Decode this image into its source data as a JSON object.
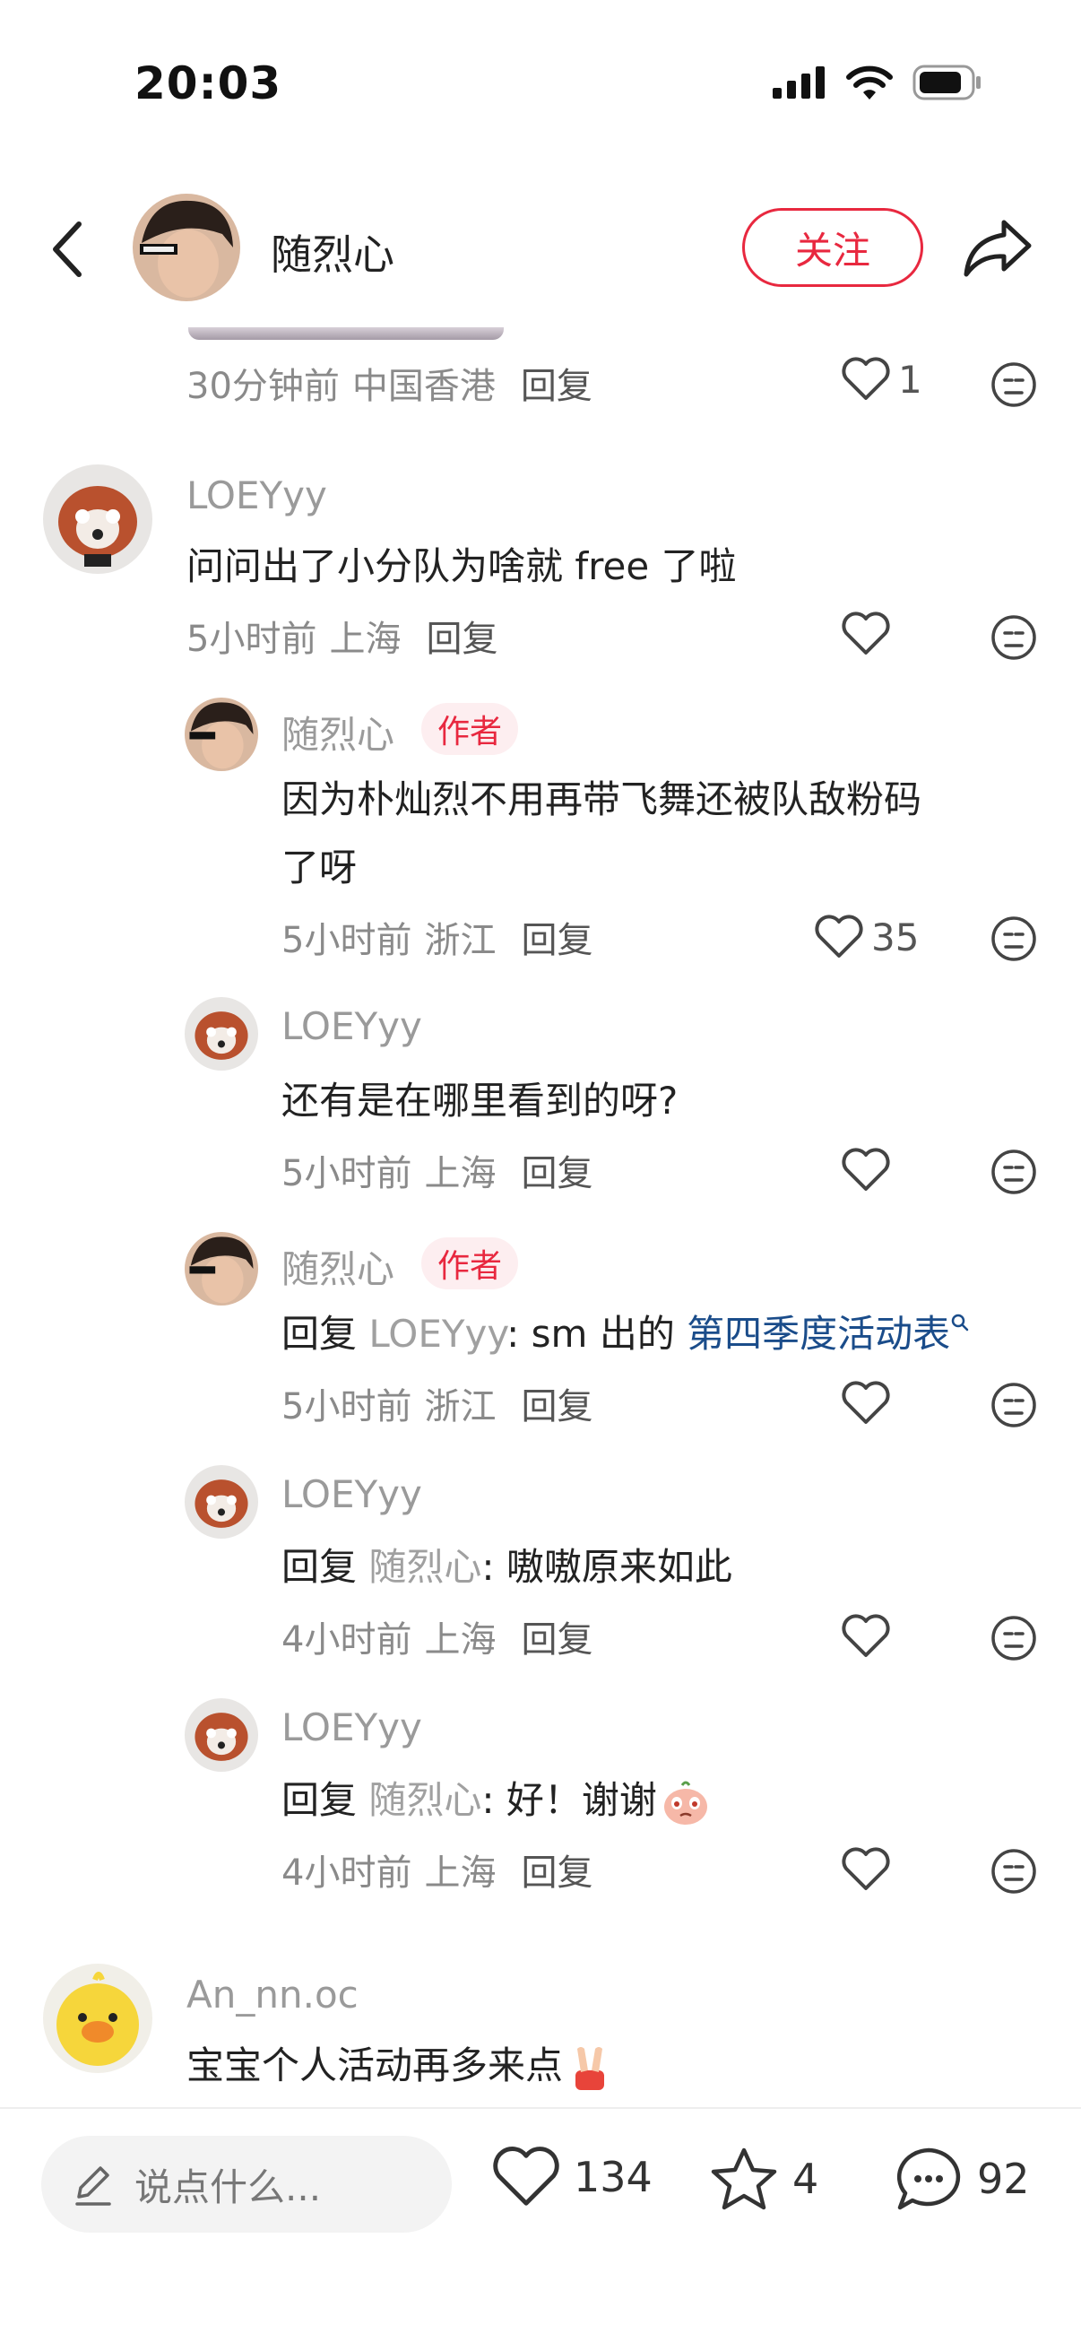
{
  "status_bar": {
    "time": "20:03"
  },
  "header": {
    "author_name": "随烈心",
    "follow_label": "关注"
  },
  "top_comment_meta": {
    "time": "30分钟前",
    "location": "中国香港",
    "reply": "回复",
    "likes": "1"
  },
  "comment1": {
    "name": "LOEYyy",
    "text": "问问出了小分队为啥就 free 了啦",
    "time": "5小时前",
    "location": "上海",
    "reply": "回复",
    "likes": ""
  },
  "reply1": {
    "name": "随烈心",
    "tag": "作者",
    "text_line1": "因为朴灿烈不用再带飞舞还被队敌粉码",
    "text_line2": "了呀",
    "time": "5小时前",
    "location": "浙江",
    "reply": "回复",
    "likes": "35"
  },
  "reply2": {
    "name": "LOEYyy",
    "text": "还有是在哪里看到的呀?",
    "time": "5小时前",
    "location": "上海",
    "reply": "回复"
  },
  "reply3": {
    "name": "随烈心",
    "tag": "作者",
    "prefix": "回复 ",
    "mention": "LOEYyy",
    "body": ": sm 出的 ",
    "topic": "第四季度活动表",
    "time": "5小时前",
    "location": "浙江",
    "reply": "回复"
  },
  "reply4": {
    "name": "LOEYyy",
    "prefix": "回复 ",
    "mention": "随烈心",
    "body": ": 嗷嗷原来如此",
    "time": "4小时前",
    "location": "上海",
    "reply": "回复"
  },
  "reply5": {
    "name": "LOEYyy",
    "prefix": "回复 ",
    "mention": "随烈心",
    "body": ": 好！谢谢",
    "time": "4小时前",
    "location": "上海",
    "reply": "回复"
  },
  "comment2": {
    "name": "An_nn.oc",
    "text": "宝宝个人活动再多来点"
  },
  "bottom_bar": {
    "input_placeholder": "说点什么...",
    "likes": "134",
    "stars": "4",
    "comments": "92"
  }
}
